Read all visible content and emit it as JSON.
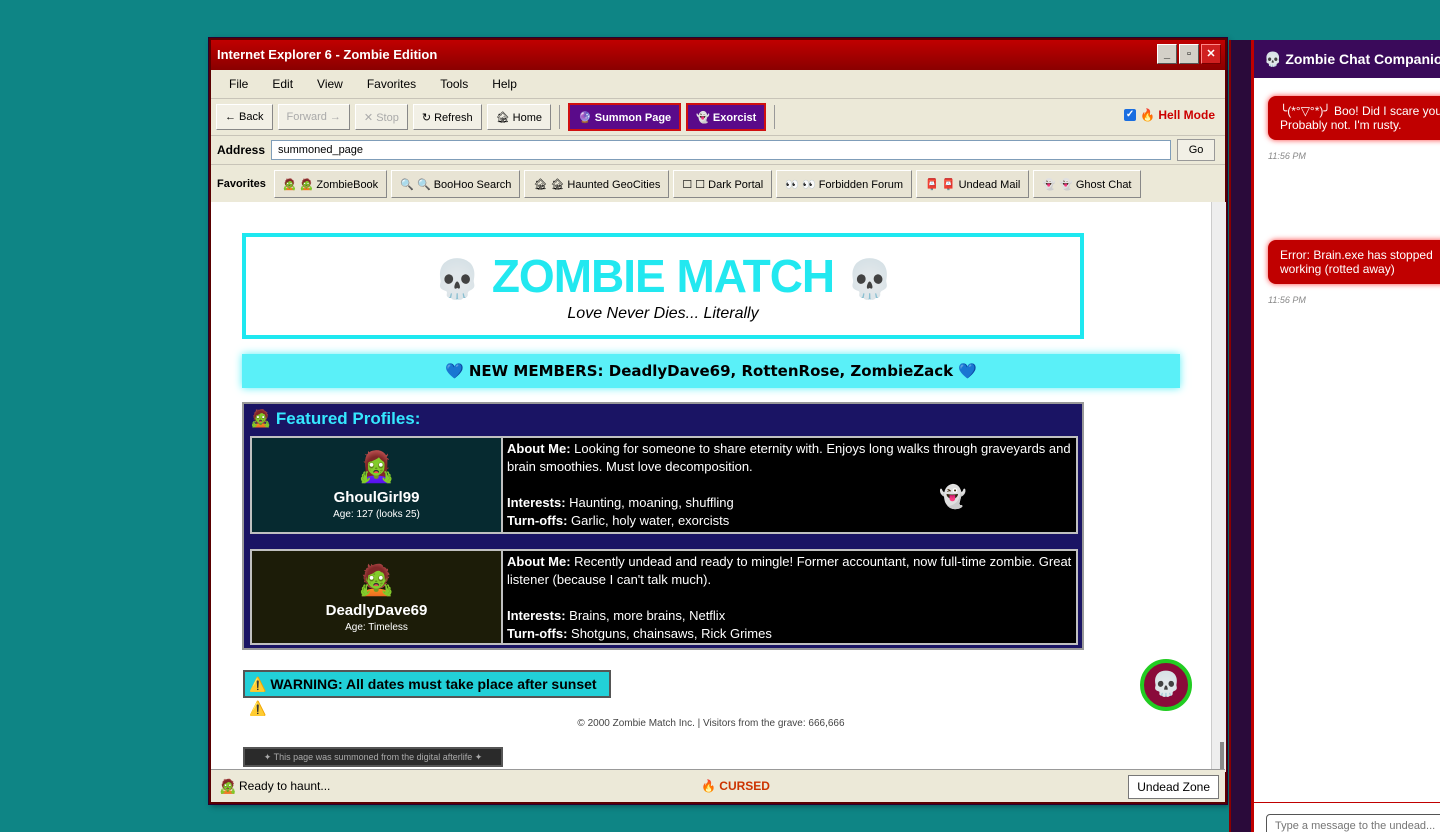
{
  "browser": {
    "title": "Internet Explorer 6 - Zombie Edition",
    "window_buttons": {
      "minimize": "_",
      "maximize": "▫",
      "close": "✕"
    },
    "menu": [
      "File",
      "Edit",
      "View",
      "Favorites",
      "Tools",
      "Help"
    ],
    "toolbar": {
      "back": "← Back",
      "forward": "Forward →",
      "stop": "✕ Stop",
      "refresh": "↻ Refresh",
      "home": "🏚 Home",
      "summon": "🔮 Summon Page",
      "exorcist": "👻 Exorcist",
      "hell_mode": "🔥 Hell Mode",
      "hell_mode_checked": true
    },
    "address": {
      "label": "Address",
      "value": "summoned_page",
      "go": "Go"
    },
    "favorites": {
      "label": "Favorites",
      "items": [
        "🧟 🧟 ZombieBook",
        "🔍 🔍 BooHoo Search",
        "🏚 🏚 Haunted GeoCities",
        "☐ ☐ Dark Portal",
        "👀 👀 Forbidden Forum",
        "📮 📮 Undead Mail",
        "👻 👻 Ghost Chat"
      ]
    },
    "status": {
      "icon": "🧟",
      "text": "Ready to haunt...",
      "cursed": "🔥 CURSED",
      "zone": "Undead Zone"
    }
  },
  "page": {
    "title": "ZOMBIE MATCH",
    "skull_left": "💀",
    "skull_right": "💀",
    "subtitle": "Love Never Dies... Literally",
    "new_members": "💙 NEW MEMBERS: DeadlyDave69, RottenRose, ZombieZack 💙",
    "featured_title": "🧟 Featured Profiles:",
    "profiles": [
      {
        "avatar": "🧟‍♀️",
        "name": "GhoulGirl99",
        "age": "Age: 127 (looks 25)",
        "about_label": "About Me:",
        "about": " Looking for someone to share eternity with. Enjoys long walks through graveyards and brain smoothies. Must love decomposition.",
        "interests_label": "Interests:",
        "interests": " Haunting, moaning, shuffling",
        "turnoffs_label": "Turn-offs:",
        "turnoffs": " Garlic, holy water, exorcists",
        "bg": "#062a30"
      },
      {
        "avatar": "🧟",
        "name": "DeadlyDave69",
        "age": "Age: Timeless",
        "about_label": "About Me:",
        "about": " Recently undead and ready to mingle! Former accountant, now full-time zombie. Great listener (because I can't talk much).",
        "interests_label": "Interests:",
        "interests": " Brains, more brains, Netflix",
        "turnoffs_label": "Turn-offs:",
        "turnoffs": " Shotguns, chainsaws, Rick Grimes",
        "bg": "#1c1c08"
      }
    ],
    "ghost": "👻",
    "warning": "⚠️ WARNING: All dates must take place after sunset ⚠️",
    "copyright": "© 2000 Zombie Match Inc. | Visitors from the grave: 666,666",
    "summoned_badge": "✦ This page was summoned from the digital afterlife ✦",
    "fab_icon": "💀"
  },
  "chat": {
    "title": "💀 Zombie Chat Companion",
    "messages": [
      {
        "text": "╰(*°▽°*)╯ Boo! Did I scare you? Probably not. I'm rusty.",
        "time": "11:56 PM"
      },
      {
        "text": "Error: Brain.exe has stopped working (rotted away)",
        "time": "11:56 PM"
      }
    ],
    "input_placeholder": "Type a message to the undead..."
  },
  "colors": {
    "desktop": "#0e8585",
    "accent_cyan": "#22e8f0",
    "title_red": "#c00000"
  }
}
